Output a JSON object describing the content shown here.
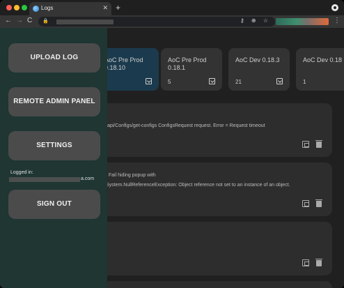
{
  "browser": {
    "tab_title": "Logs",
    "tab_close": "✕",
    "new_tab": "+",
    "back": "←",
    "forward": "→",
    "reload": "C",
    "lock": "🔒",
    "omnibox_icons": "⚷ ⊕ ☆",
    "menu": "⋮"
  },
  "builds": [
    {
      "name": "AoC Pre Prod 0.18.10",
      "count": "",
      "selected": true
    },
    {
      "name": "AoC Pre Prod 0.18.1",
      "count": "5",
      "selected": false
    },
    {
      "name": "AoC Dev 0.18.3",
      "count": "21",
      "selected": false
    },
    {
      "name": "AoC Dev 0.18",
      "count": "1",
      "selected": false
    }
  ],
  "logs": [
    {
      "lines": [
        "/api/Configs/get-configs ConfigsRequest request. Error = Request timeout"
      ]
    },
    {
      "lines": [
        "] Fail hiding popup with",
        "System.NullReferenceException: Object reference not set to an instance of an object."
      ]
    },
    {
      "lines": []
    }
  ],
  "sidebar": {
    "upload_label": "UPLOAD LOG",
    "remote_admin_label": "REMOTE ADMIN PANEL",
    "settings_label": "SETTINGS",
    "logged_in_label": "Logged in:",
    "email_suffix": "a.com",
    "sign_out_label": "SIGN OUT"
  },
  "colors": {
    "sidebar_bg": "#1f3633",
    "selected_card": "#1b3a4d",
    "button_bg": "#4b4b4b"
  }
}
